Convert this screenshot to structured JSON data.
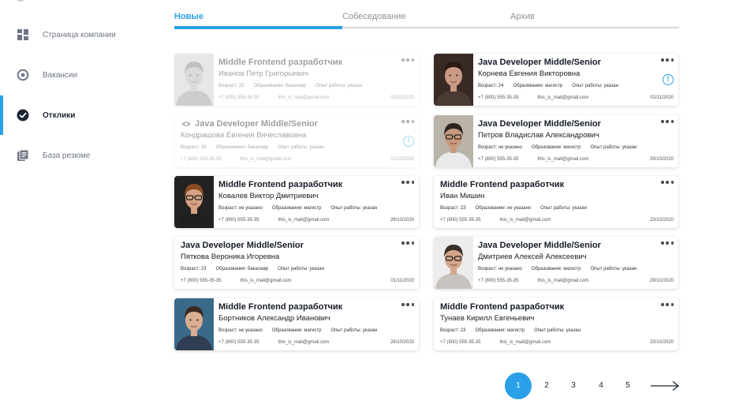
{
  "sidebar": {
    "items": [
      {
        "label": "Страница компании",
        "icon": "grid-icon"
      },
      {
        "label": "Вакансии",
        "icon": "target-icon"
      },
      {
        "label": "Отклики",
        "icon": "check-circle-icon",
        "active": true
      },
      {
        "label": "База резюме",
        "icon": "documents-icon"
      }
    ]
  },
  "tabs": [
    {
      "label": "Новые",
      "active": true
    },
    {
      "label": "Собеседование"
    },
    {
      "label": "Архив"
    }
  ],
  "labels": {
    "age": "Возраст:",
    "education": "Образование:",
    "experience": "Опыт работы:"
  },
  "cards": [
    {
      "title": "Middle Frontend разработчик",
      "name": "Иванов Петр Григорьевич",
      "age": "25",
      "education": "бакалавр",
      "experience": "указан",
      "phone": "+7 (800) 555-35-35",
      "email": "this_is_mail@gmail.com",
      "date": "03/11/2020",
      "viewed": true
    },
    {
      "title": "Java Developer Middle/Senior",
      "name": "Корнева Евгения Викторовна",
      "age": "24",
      "education": "магистр",
      "experience": "указан",
      "phone": "+7 (800) 555-35-35",
      "email": "this_is_mail@gmail.com",
      "date": "02/11/2020",
      "alert": "!"
    },
    {
      "title": "Java Developer Middle/Senior",
      "name": "Кондрашова Евгения Вячеславовна",
      "age": "28",
      "education": "бакалавр",
      "experience": "указан",
      "phone": "+7 (800) 555-35-35",
      "email": "this_is_mail@gmail.com",
      "date": "01/11/2020",
      "viewed": true,
      "alert": "!"
    },
    {
      "title": "Java Developer Middle/Senior",
      "name": "Петров Владислав Александрович",
      "age": "не указано",
      "education": "магистр",
      "experience": "указан",
      "phone": "+7 (800) 555-35-35",
      "email": "this_is_mail@gmail.com",
      "date": "29/10/2020"
    },
    {
      "title": "Middle Frontend разработчик",
      "name": "Ковалев Виктор Дмитриевич",
      "age": "не указано",
      "education": "магистр",
      "experience": "указан",
      "phone": "+7 (800) 555-35-35",
      "email": "this_is_mail@gmail.com",
      "date": "26/10/2020"
    },
    {
      "title": "Middle Frontend разработчик",
      "name": "Иван Мишин",
      "age": "23",
      "education": "не указано",
      "experience": "указан",
      "phone": "+7 (800) 555-35-35",
      "email": "this_is_mail@gmail.com",
      "date": "23/10/2020"
    },
    {
      "title": "Java Developer Middle/Senior",
      "name": "Пяткова Вероника Игоревна",
      "age": "23",
      "education": "бакалавр",
      "experience": "указан",
      "phone": "+7 (800) 555-35-35",
      "email": "this_is_mail@gmail.com",
      "date": "01/11/2020"
    },
    {
      "title": "Java Developer Middle/Senior",
      "name": "Дмитриев Алексей Алексеевич",
      "age": "не указано",
      "education": "магистр",
      "experience": "указан",
      "phone": "+7 (800) 555-35-35",
      "email": "this_is_mail@gmail.com",
      "date": "29/10/2020"
    },
    {
      "title": "Middle Frontend разработчик",
      "name": "Бортников Александр Иванович",
      "age": "не указано",
      "education": "магистр",
      "experience": "указан",
      "phone": "+7 (800) 555-35-35",
      "email": "this_is_mail@gmail.com",
      "date": "26/10/2020"
    },
    {
      "title": "Middle Frontend разработчик",
      "name": "Тунаев Кирилл Евгеньевич",
      "age": "23",
      "education": "магистр",
      "experience": "указан",
      "phone": "+7 (800) 555-35-35",
      "email": "this_is_mail@gmail.com",
      "date": "23/10/2020"
    }
  ],
  "pagination": {
    "pages": [
      "1",
      "2",
      "3",
      "4",
      "5"
    ],
    "current": "1",
    "next_icon": "arrow-right-icon"
  },
  "colors": {
    "accent": "#2aa0e8",
    "text_dark": "#1c2433",
    "text_muted": "#6f7785"
  }
}
